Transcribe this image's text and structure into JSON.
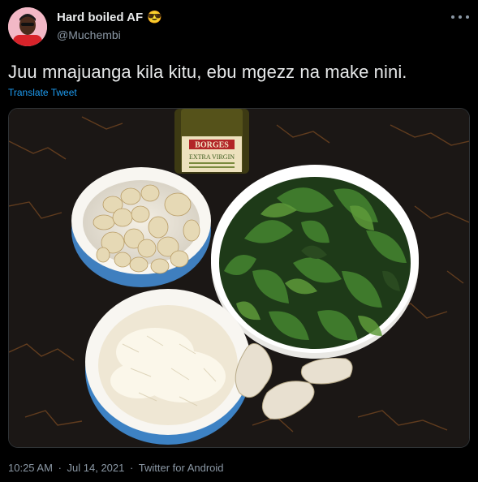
{
  "author": {
    "display_name": "Hard boiled AF",
    "emoji": "😎",
    "handle": "@Muchembi"
  },
  "tweet": {
    "text": "Juu mnajuanga kila kitu, ebu mgezz na make nini.",
    "translate_label": "Translate Tweet"
  },
  "media": {
    "bottle_label_brand": "BORGES",
    "bottle_label_line2": "EXTRA VIRGIN"
  },
  "meta": {
    "time": "10:25 AM",
    "separator": "·",
    "date": "Jul 14, 2021",
    "source": "Twitter for Android"
  },
  "colors": {
    "background": "#000000",
    "text_primary": "#e7e9ea",
    "text_secondary": "#8b98a5",
    "link": "#1d9bf0"
  }
}
